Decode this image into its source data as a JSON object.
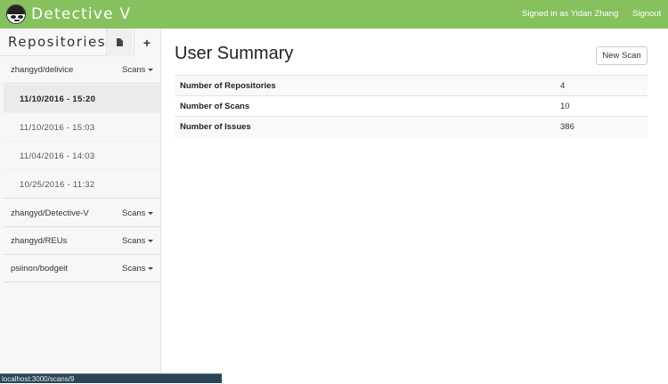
{
  "navbar": {
    "brand": "Detective V",
    "signed_in": "Signed in as Yidan Zhang",
    "signout": "Signout"
  },
  "sidebar": {
    "title": "Repositories",
    "repos": [
      {
        "name": "zhangyd/delivice",
        "scans_label": "Scans"
      },
      {
        "name": "zhangyd/Detective-V",
        "scans_label": "Scans"
      },
      {
        "name": "zhangyd/REUs",
        "scans_label": "Scans"
      },
      {
        "name": "psiinon/bodgeit",
        "scans_label": "Scans"
      }
    ],
    "scans": [
      "11/10/2016 - 15:20",
      "11/10/2016 - 15:03",
      "11/04/2016 - 14:03",
      "10/25/2016 - 11:32"
    ]
  },
  "main": {
    "title": "User Summary",
    "new_scan": "New Scan",
    "rows": [
      {
        "label": "Number of Repositories",
        "value": "4"
      },
      {
        "label": "Number of Scans",
        "value": "10"
      },
      {
        "label": "Number of Issues",
        "value": "386"
      }
    ]
  },
  "statusbar": {
    "url": "localhost:3000/scans/9"
  }
}
